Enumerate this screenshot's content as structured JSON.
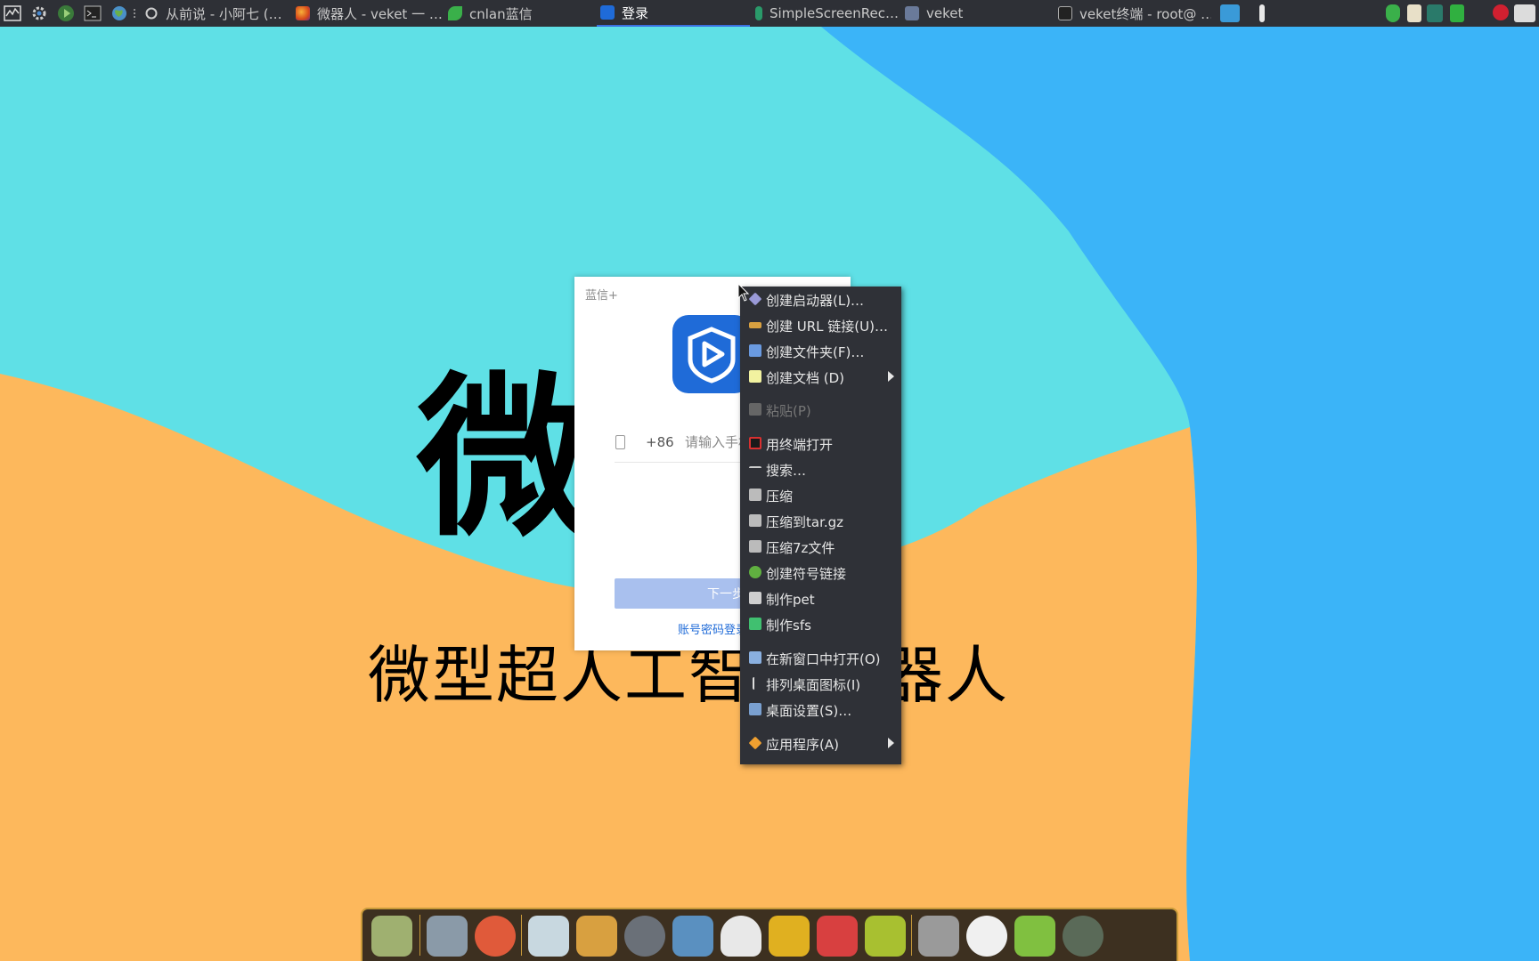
{
  "colors": {
    "wallpaper_cyan": "#5fe0e6",
    "wallpaper_blue": "#3bb4f8",
    "wallpaper_orange": "#fdb85c",
    "panel_bg": "#2e3036",
    "menu_bg": "#2f3137",
    "accent": "#1f6bd8"
  },
  "wallpaper": {
    "title": "微",
    "subtitle": "微型超人工智能机器人"
  },
  "taskbar": {
    "launchers": [
      "activity-monitor-icon",
      "settings-gear-icon",
      "play-icon",
      "terminal-icon",
      "globe-icon",
      "dots-icon",
      "circle-icon"
    ],
    "tasks": [
      {
        "label": "从前说 - 小阿七 (…",
        "icon": "music-icon"
      },
      {
        "label": "微器人 - veket 一 …",
        "icon": "firefox-icon"
      },
      {
        "label": "cnlan蓝信",
        "icon": "leaf-icon"
      },
      {
        "label": "登录",
        "icon": "lanxin-icon",
        "active": true
      },
      {
        "label": "SimpleScreenRec…",
        "icon": "recorder-icon"
      },
      {
        "label": "veket",
        "icon": "folder-icon"
      },
      {
        "label": "veket终端 - root@ …",
        "icon": "terminal-icon"
      }
    ],
    "tray": [
      "monitor-icon",
      "battery-icon",
      "shield-icon",
      "clipboard-icon",
      "network-icon",
      "storage-icon",
      "record-icon",
      "keyboard-icon"
    ]
  },
  "login": {
    "title": "蓝信+",
    "country_code": "+86",
    "phone_placeholder": "请输入手机号",
    "next_button": "下一步",
    "alt_login": "账号密码登录"
  },
  "menu": {
    "items": [
      {
        "label": "创建启动器(L)…",
        "icon": "launcher-icon",
        "icon_color": "#9a9ad8"
      },
      {
        "label": "创建 URL 链接(U)…",
        "icon": "url-link-icon",
        "icon_color": "#d8a040"
      },
      {
        "label": "创建文件夹(F)…",
        "icon": "folder-icon",
        "icon_color": "#6a9ae0"
      },
      {
        "label": "创建文档 (D)",
        "icon": "document-icon",
        "icon_color": "#f2f2a0",
        "submenu": true
      },
      {
        "label": "粘贴(P)",
        "icon": "paste-icon",
        "icon_color": "#777777",
        "disabled": true
      },
      {
        "label": "用终端打开",
        "icon": "terminal-icon",
        "icon_color": "#d83030"
      },
      {
        "label": "搜索…",
        "icon": "search-icon",
        "icon_color": "#cccccc"
      },
      {
        "label": "压缩",
        "icon": "archive-icon",
        "icon_color": "#bbbbbb"
      },
      {
        "label": "压缩到tar.gz",
        "icon": "archive-icon",
        "icon_color": "#bbbbbb"
      },
      {
        "label": "压缩7z文件",
        "icon": "archive-icon",
        "icon_color": "#bbbbbb"
      },
      {
        "label": "创建符号链接",
        "icon": "symlink-icon",
        "icon_color": "#60b040"
      },
      {
        "label": "制作pet",
        "icon": "package-icon",
        "icon_color": "#cfcfcf"
      },
      {
        "label": "制作sfs",
        "icon": "sfs-icon",
        "icon_color": "#40c070"
      },
      {
        "label": "在新窗口中打开(O)",
        "icon": "new-window-icon",
        "icon_color": "#8ab0e0"
      },
      {
        "label": "排列桌面图标(I)",
        "icon": "sort-icon",
        "icon_color": "#dddddd"
      },
      {
        "label": "桌面设置(S)…",
        "icon": "desktop-settings-icon",
        "icon_color": "#7aa0d0"
      },
      {
        "label": "应用程序(A)",
        "icon": "applications-icon",
        "icon_color": "#f0a030",
        "submenu": true
      }
    ]
  },
  "dock": {
    "items": [
      {
        "icon": "files-icon",
        "color": "#9fb070"
      },
      {
        "icon": "display-icon",
        "color": "#8a9aa8"
      },
      {
        "icon": "pet-icon",
        "color": "#e05a3a"
      },
      {
        "icon": "notebook-icon",
        "color": "#c8d8e0"
      },
      {
        "icon": "paint-icon",
        "color": "#d8a040"
      },
      {
        "icon": "speaker-icon",
        "color": "#6a7078"
      },
      {
        "icon": "users-icon",
        "color": "#5a90c0"
      },
      {
        "icon": "penguin-icon",
        "color": "#e8e8e8"
      },
      {
        "icon": "book-icon",
        "color": "#e0b020"
      },
      {
        "icon": "chart-icon",
        "color": "#d84040"
      },
      {
        "icon": "help-icon",
        "color": "#a8c030"
      },
      {
        "icon": "drive-icon",
        "color": "#9a9a9a"
      },
      {
        "icon": "brightness-icon",
        "color": "#f0f0f0"
      },
      {
        "icon": "editor-icon",
        "color": "#80c040"
      },
      {
        "icon": "camera-icon",
        "color": "#5a6a58"
      }
    ]
  }
}
